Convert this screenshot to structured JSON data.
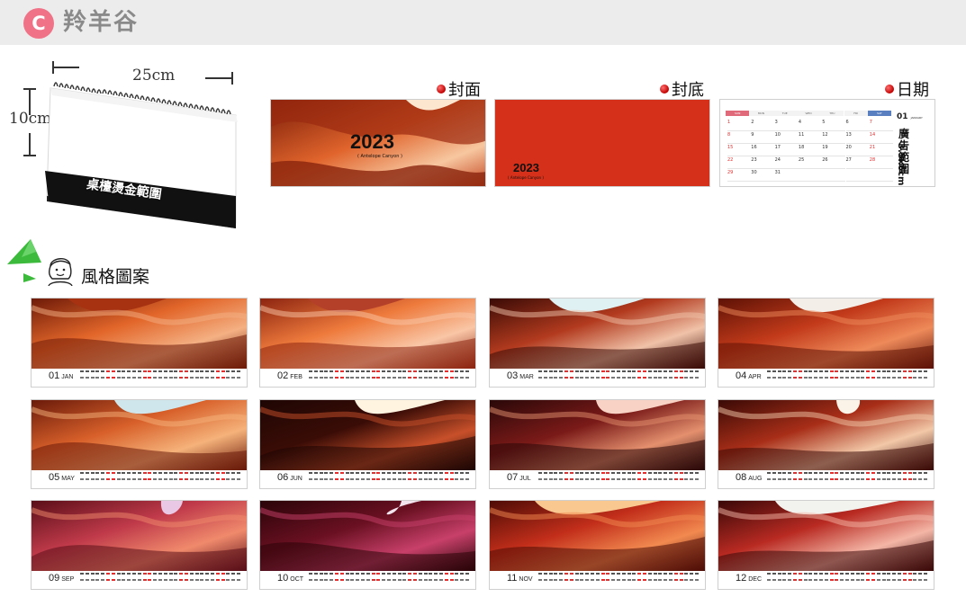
{
  "header": {
    "badge": "C",
    "title": "羚羊谷"
  },
  "desk": {
    "width_label": "25cm",
    "height_label": "10cm",
    "base_text": "桌檯燙金範圍"
  },
  "previews": {
    "cover": {
      "label": "封面",
      "year": "2023",
      "subtitle": "( Antelope Canyon )"
    },
    "back": {
      "label": "封底",
      "year": "2023",
      "subtitle": "( Antelope Canyon )"
    },
    "date": {
      "label": "日期",
      "month_num": "01",
      "month_name": "JANUARY",
      "ad_size": "3.5x6cm",
      "ad_text": "廣告範圍",
      "weekdays": [
        "SUN",
        "MON",
        "TUE",
        "WED",
        "THU",
        "FRI",
        "SAT"
      ],
      "weeks": [
        [
          "1",
          "2",
          "3",
          "4",
          "5",
          "6",
          "7"
        ],
        [
          "8",
          "9",
          "10",
          "11",
          "12",
          "13",
          "14"
        ],
        [
          "15",
          "16",
          "17",
          "18",
          "19",
          "20",
          "21"
        ],
        [
          "22",
          "23",
          "24",
          "25",
          "26",
          "27",
          "28"
        ],
        [
          "29",
          "30",
          "31",
          "",
          "",
          "",
          ""
        ]
      ]
    }
  },
  "style_section": {
    "title": "風格圖案"
  },
  "months": [
    {
      "num": "01",
      "name": "JAN"
    },
    {
      "num": "02",
      "name": "FEB"
    },
    {
      "num": "03",
      "name": "MAR"
    },
    {
      "num": "04",
      "name": "APR"
    },
    {
      "num": "05",
      "name": "MAY"
    },
    {
      "num": "06",
      "name": "JUN"
    },
    {
      "num": "07",
      "name": "JUL"
    },
    {
      "num": "08",
      "name": "AUG"
    },
    {
      "num": "09",
      "name": "SEP"
    },
    {
      "num": "10",
      "name": "OCT"
    },
    {
      "num": "11",
      "name": "NOV"
    },
    {
      "num": "12",
      "name": "DEC"
    }
  ],
  "colors": {
    "badge": "#f07287",
    "cover_red": "#d4301a",
    "accent_red": "#e03030",
    "icon_green": "#3cba3c"
  },
  "icons": [
    "green-triangle-icon",
    "girl-face-icon",
    "red-dot-icon"
  ]
}
